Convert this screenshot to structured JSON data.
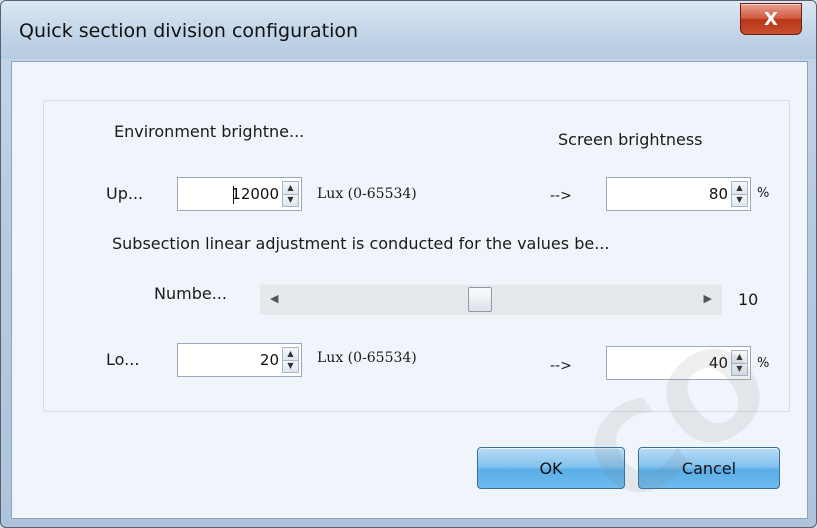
{
  "window": {
    "title": "Quick section division configuration",
    "close_label": "X"
  },
  "config": {
    "env_brightness_header": "Environment brightne...",
    "screen_brightness_header": "Screen brightness",
    "upper": {
      "label": "Up...",
      "lux_value": "12000",
      "lux_range": "Lux (0-65534)",
      "arrow": "-->",
      "screen_value": "80",
      "unit": "%"
    },
    "note": "Subsection linear adjustment is conducted for the values be...",
    "number": {
      "label": "Numbe...",
      "value": "10",
      "slider_fraction": 0.47
    },
    "lower": {
      "label": "Lo...",
      "lux_value": "20",
      "lux_range": "Lux (0-65534)",
      "arrow": "-->",
      "screen_value": "40",
      "unit": "%"
    }
  },
  "buttons": {
    "ok": "OK",
    "cancel": "Cancel"
  },
  "watermark": "CO"
}
